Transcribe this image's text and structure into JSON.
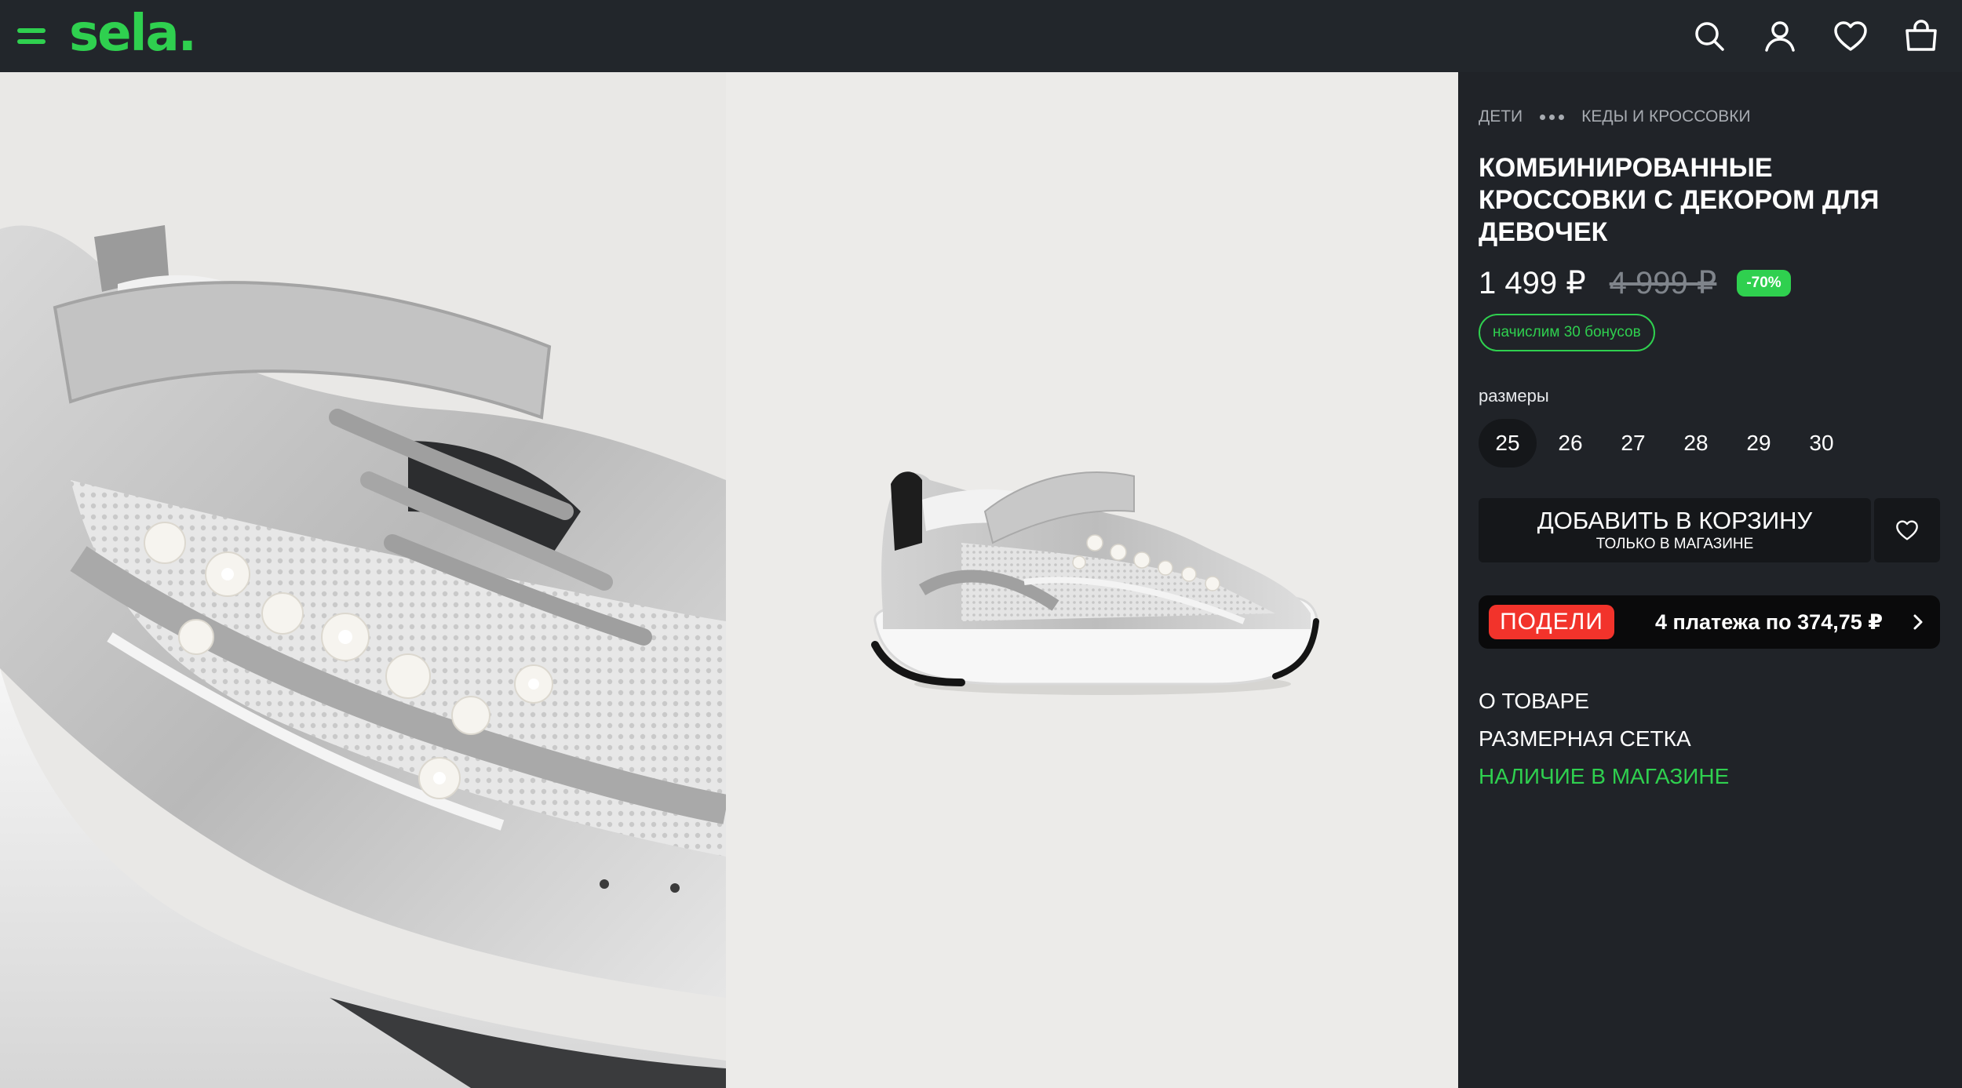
{
  "header": {
    "logo": "sela.",
    "icons": [
      "search-icon",
      "account-icon",
      "heart-icon",
      "bag-icon"
    ]
  },
  "gallery": {
    "images": [
      "sneaker-closeup",
      "sneaker-side-view"
    ]
  },
  "product": {
    "breadcrumb": [
      "ДЕТИ",
      "КЕДЫ И КРОССОВКИ"
    ],
    "title": "КОМБИНИРОВАННЫЕ КРОССОВКИ С ДЕКОРОМ ДЛЯ ДЕВОЧЕК",
    "price": "1 499 ₽",
    "old_price": "4 999 ₽",
    "discount": "-70%",
    "bonus": "начислим 30 бонусов",
    "sizes_label": "размеры",
    "sizes": [
      "25",
      "26",
      "27",
      "28",
      "29",
      "30"
    ],
    "selected_size": "25",
    "add_to_cart": "ДОБАВИТЬ В КОРЗИНУ",
    "add_to_cart_sub": "ТОЛЬКО В МАГАЗИНЕ",
    "podeli_logo": "ПОДЕЛИ",
    "podeli_text": "4 платежа по 374,75 ₽",
    "links": [
      "О ТОВАРЕ",
      "РАЗМЕРНАЯ СЕТКА",
      "НАЛИЧИЕ В МАГАЗИНЕ"
    ]
  },
  "colors": {
    "accent": "#2fd04f",
    "header_bg": "#22262b",
    "panel_bg": "#202328",
    "podeli_red": "#f2332b"
  }
}
